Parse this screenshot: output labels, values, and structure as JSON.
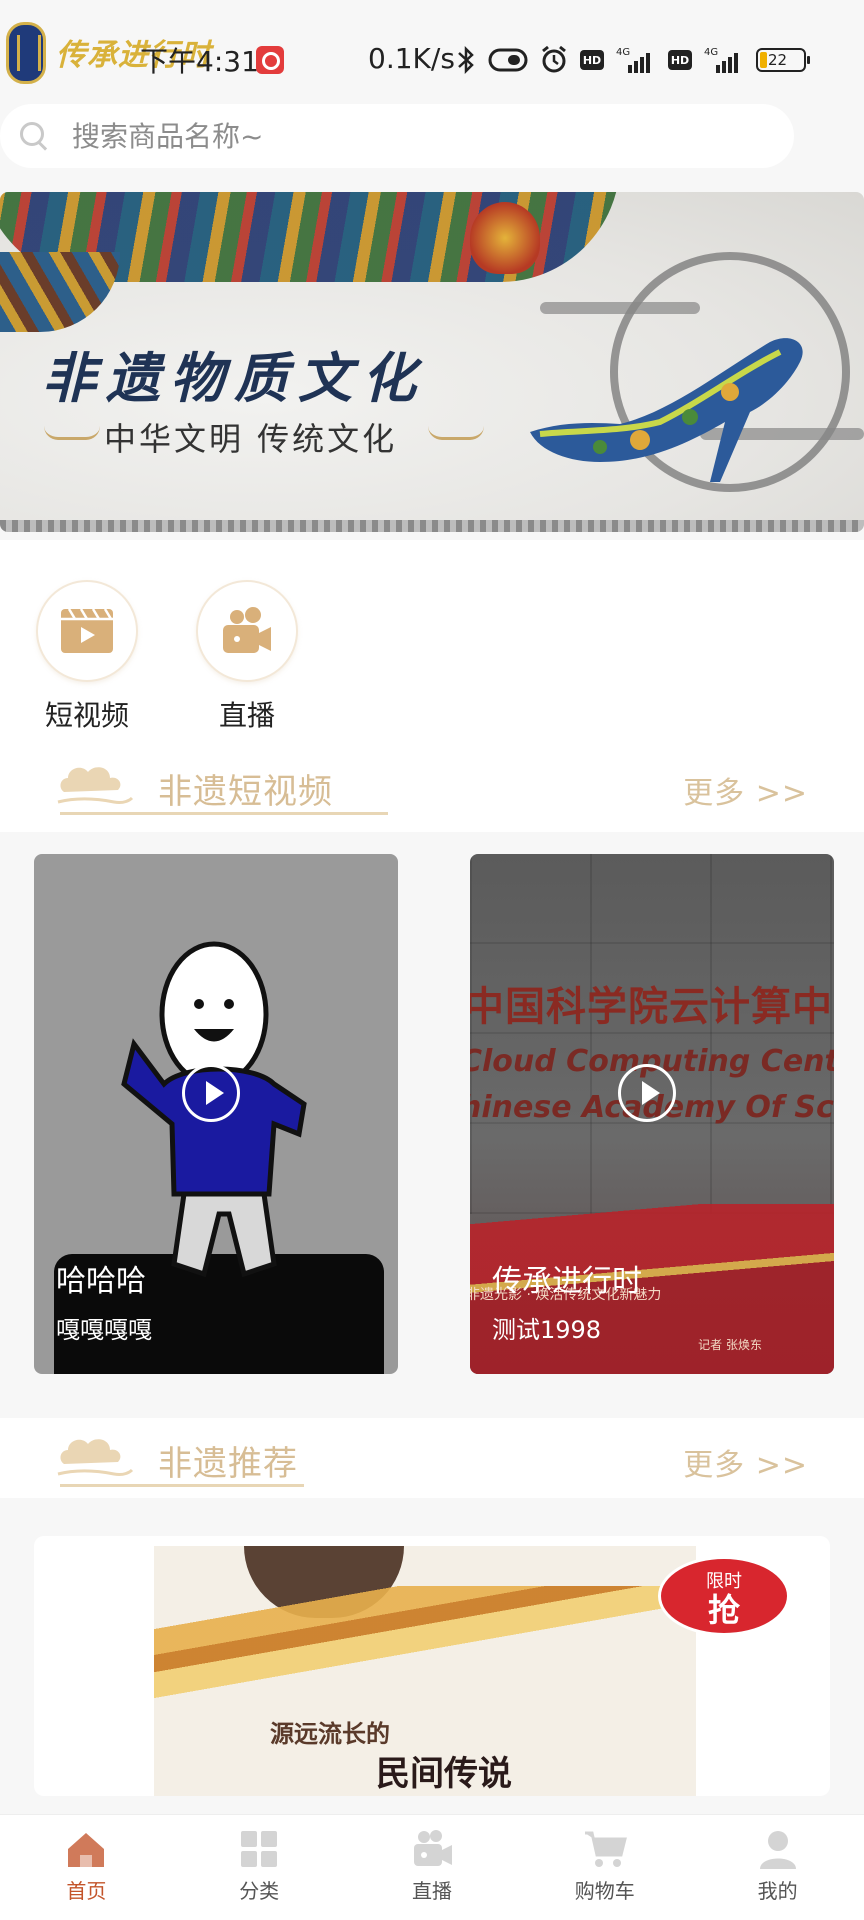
{
  "status_bar": {
    "app_logo_text": "传承进行时",
    "time": "下午4:31",
    "net_speed": "0.1K/s",
    "battery": "22"
  },
  "search": {
    "placeholder": "搜索商品名称~"
  },
  "banner": {
    "title": "非遗物质文化",
    "subtitle": "中华文明 传统文化"
  },
  "shortcuts": [
    {
      "label": "短视频",
      "icon": "video-clip-icon"
    },
    {
      "label": "直播",
      "icon": "live-camera-icon"
    }
  ],
  "sections": {
    "videos": {
      "title": "非遗短视频",
      "more": "更多 >>"
    },
    "recommend": {
      "title": "非遗推荐",
      "more": "更多 >>"
    }
  },
  "videos": [
    {
      "title": "哈哈哈",
      "subtitle": "嘎嘎嘎嘎"
    },
    {
      "title": "传承进行时",
      "subtitle": "测试1998"
    }
  ],
  "video2_scene": {
    "sign_cn": "中国科学院云计算中",
    "sign_en1": "Cloud Computing Center",
    "sign_en2": "hinese Academy Of Science",
    "ribbon_text": "非遗光影 · 焕活传统文化新魅力",
    "reporter": "记者 张焕东"
  },
  "product": {
    "book_line1": "源远流长的",
    "book_line2": "民间传说",
    "sale_line1": "限时",
    "sale_line2": "抢"
  },
  "tabbar": [
    {
      "label": "首页",
      "icon": "home-icon",
      "active": true
    },
    {
      "label": "分类",
      "icon": "category-grid-icon",
      "active": false
    },
    {
      "label": "直播",
      "icon": "live-camera-icon",
      "active": false
    },
    {
      "label": "购物车",
      "icon": "cart-icon",
      "active": false
    },
    {
      "label": "我的",
      "icon": "user-icon",
      "active": false
    }
  ],
  "colors": {
    "accent": "#c3542a",
    "section_title": "#d7bd95",
    "icon_gold": "#d9b07a"
  }
}
